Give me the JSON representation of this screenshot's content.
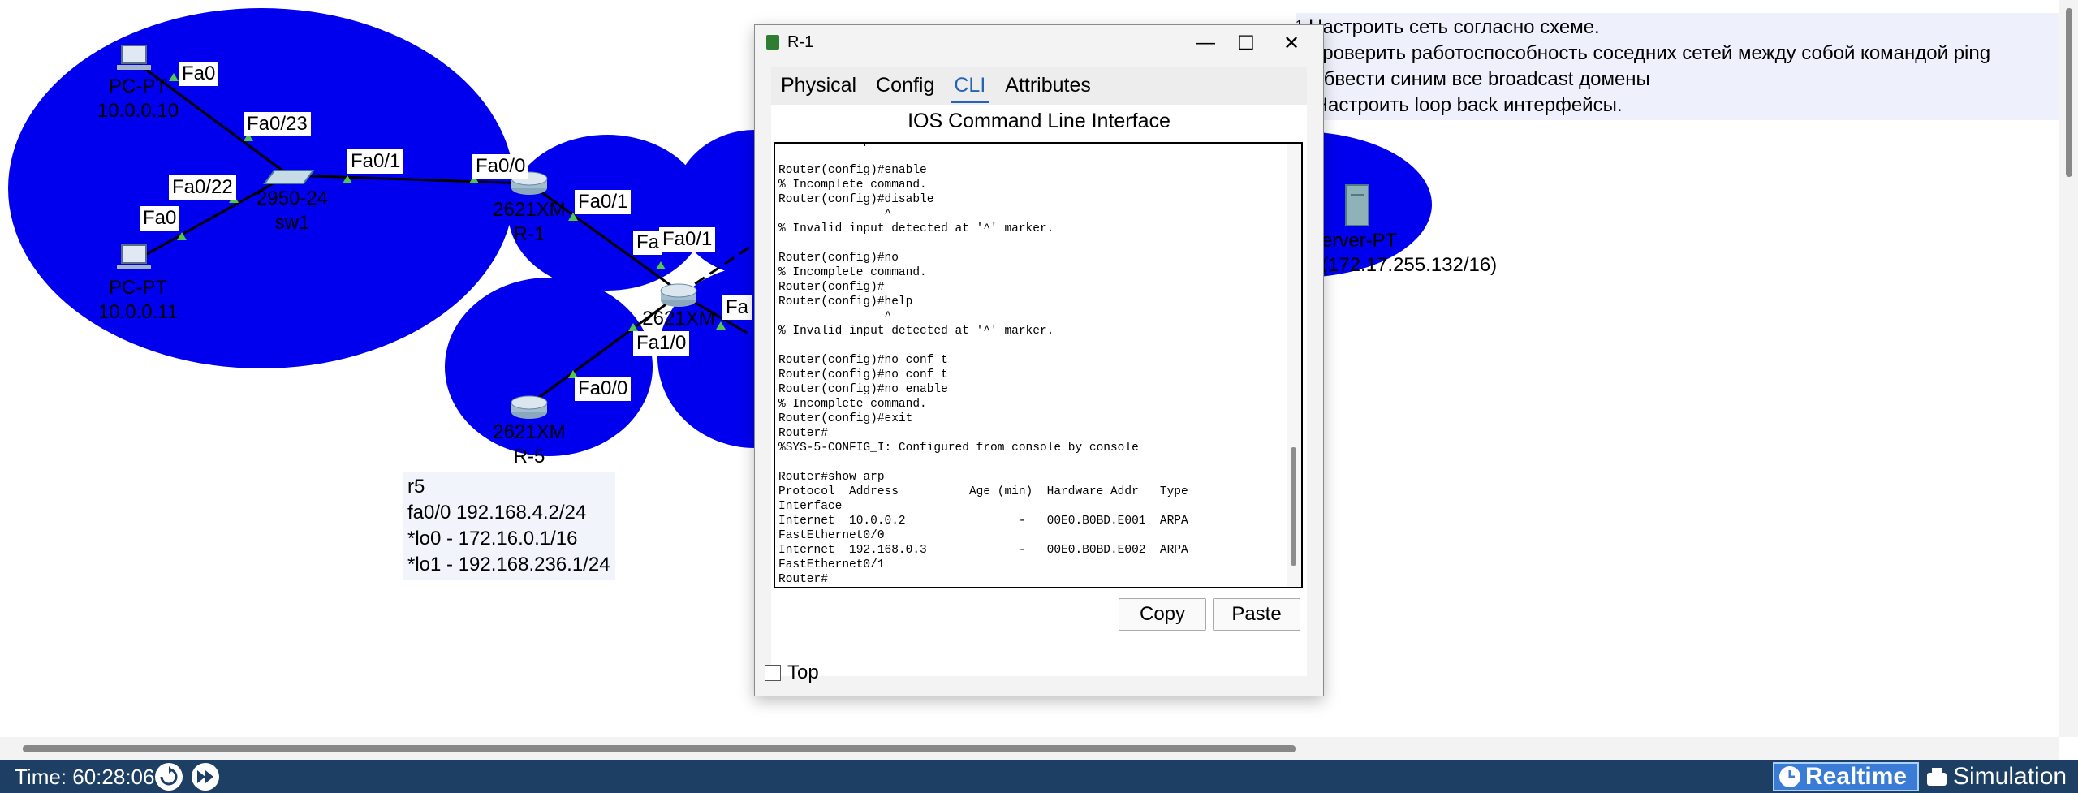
{
  "colors": {
    "domain_fill": "#0000ee",
    "statusbar": "#1d3f63",
    "realtime_btn": "#3a7bd5",
    "tab_active": "#2563b9"
  },
  "topology": {
    "devices": [
      {
        "id": "pc0",
        "model": "PC-PT",
        "name": "10.0.0.10",
        "icon": "pc-icon"
      },
      {
        "id": "pc1",
        "model": "PC-PT",
        "name": "10.0.0.11",
        "icon": "pc-icon"
      },
      {
        "id": "sw1",
        "model": "2950-24",
        "name": "sw1",
        "icon": "switch-icon"
      },
      {
        "id": "r1",
        "model": "2621XM",
        "name": "R-1",
        "icon": "router-icon"
      },
      {
        "id": "rmid",
        "model": "2621XM",
        "name": "",
        "icon": "router-icon"
      },
      {
        "id": "r5",
        "model": "2621XM",
        "name": "R-5",
        "icon": "router-icon"
      },
      {
        "id": "srv",
        "model": "erver-PT",
        "name": "(172.17.255.132/16)",
        "icon": "server-icon"
      }
    ],
    "ports": [
      "Fa0",
      "Fa0/23",
      "Fa0/22",
      "Fa0",
      "Fa0/1",
      "Fa0/0",
      "Fa0/1",
      "Fa",
      "Fa0/1",
      "Fa1/0",
      "Fa0/0",
      "Fa"
    ],
    "notes_r5": [
      "r5",
      "fa0/0 192.168.4.2/24",
      "*lo0 - 172.16.0.1/16",
      "*lo1 - 192.168.236.1/24"
    ],
    "tasks_marker": "1",
    "tasks": [
      "Настроить сеть согласно схеме.",
      "Проверить работоспособность соседних сетей между собой командой ping",
      "Обвести синим все broadcast домены",
      " Настроить loop back интерфейсы."
    ]
  },
  "dialog": {
    "title": "R-1",
    "app_icon": "packet-tracer-icon",
    "tabs": [
      {
        "label": "Physical",
        "active": false
      },
      {
        "label": "Config",
        "active": false
      },
      {
        "label": "CLI",
        "active": true
      },
      {
        "label": "Attributes",
        "active": false
      }
    ],
    "cli_heading": "IOS Command Line Interface",
    "console_lines": [
      "% Invalid input detected at '^' marker.",
      "",
      "Router(config)#enable",
      "% Incomplete command.",
      "Router(config)#disable",
      "               ^",
      "% Invalid input detected at '^' marker.",
      "",
      "Router(config)#no",
      "% Incomplete command.",
      "Router(config)#",
      "Router(config)#help",
      "               ^",
      "% Invalid input detected at '^' marker.",
      "",
      "Router(config)#no conf t",
      "Router(config)#no conf t",
      "Router(config)#no enable",
      "% Incomplete command.",
      "Router(config)#exit",
      "Router#",
      "%SYS-5-CONFIG_I: Configured from console by console",
      "",
      "Router#show arp",
      "Protocol  Address          Age (min)  Hardware Addr   Type",
      "Interface",
      "Internet  10.0.0.2                -   00E0.B0BD.E001  ARPA",
      "FastEthernet0/0",
      "Internet  192.168.0.3             -   00E0.B0BD.E002  ARPA",
      "FastEthernet0/1",
      "Router#"
    ],
    "copy_label": "Copy",
    "paste_label": "Paste",
    "top_label": "Top",
    "top_checked": false
  },
  "statusbar": {
    "time": "Time: 60:28:06",
    "realtime_label": "Realtime",
    "simulation_label": "Simulation"
  }
}
